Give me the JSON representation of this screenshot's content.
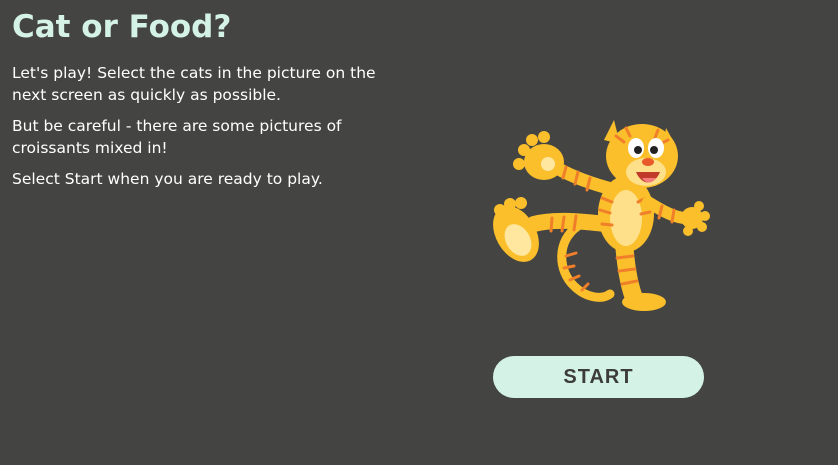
{
  "game": {
    "title": "Cat or Food?",
    "instructions": [
      "Let's play!  Select the cats in the picture on the next screen as quickly as possible.",
      "But be careful - there are some pictures of croissants mixed in!",
      "Select Start when you are ready to play."
    ],
    "start_label": "START",
    "mascot_icon": "cartoon-tiger-icon"
  },
  "colors": {
    "background": "#444442",
    "accent": "#d4f3e6",
    "text": "#ffffff",
    "button_text": "#3c3c3a",
    "tiger_body": "#fbbf2b",
    "tiger_stripes": "#f07f2a"
  }
}
